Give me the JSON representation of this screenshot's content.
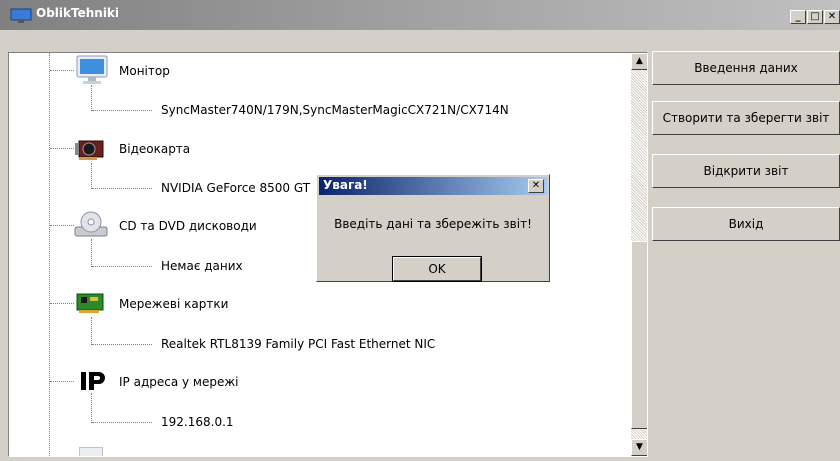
{
  "window": {
    "title": "OblikTehniki",
    "minimize_glyph": "_",
    "maximize_glyph": "□",
    "close_glyph": "✕"
  },
  "tree": {
    "nodes": [
      {
        "icon": "monitor-icon",
        "label": "Монітор",
        "child": "SyncMaster740N/179N,SyncMasterMagicCX721N/CX714N"
      },
      {
        "icon": "video-card-icon",
        "label": "Відеокарта",
        "child": "NVIDIA GeForce 8500 GT"
      },
      {
        "icon": "cd-dvd-icon",
        "label": "CD та DVD дисководи",
        "child": "Немає даних"
      },
      {
        "icon": "network-card-icon",
        "label": "Мережеві картки",
        "child": "Realtek RTL8139 Family PCI Fast Ethernet NIC"
      },
      {
        "icon": "ip-icon",
        "label": "IP адреса у мережі",
        "child": "192.168.0.1"
      }
    ]
  },
  "scrollbar": {
    "up_glyph": "▲",
    "down_glyph": "▼"
  },
  "sidebar": {
    "buttons": [
      {
        "label": "Введення даних"
      },
      {
        "label": "Створити та зберегти звіт"
      },
      {
        "label": "Відкрити звіт"
      },
      {
        "label": "Вихід"
      }
    ]
  },
  "dialog": {
    "title": "Увага!",
    "message": "Введіть дані та збережіть звіт!",
    "ok_label": "OK",
    "close_glyph": "✕"
  }
}
